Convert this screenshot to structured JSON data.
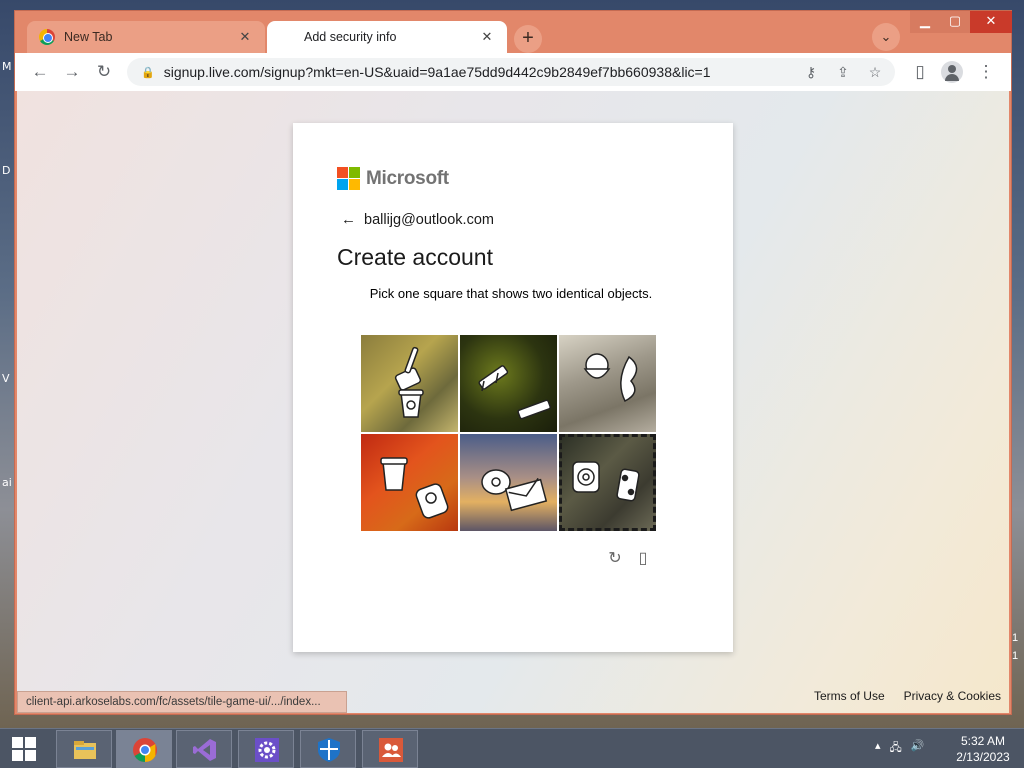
{
  "desktop": {
    "left_letters": [
      "M",
      "D",
      "V",
      "ai"
    ],
    "right_letters": [
      "1",
      "1"
    ]
  },
  "browser": {
    "tabs": [
      {
        "title": "New Tab",
        "close": "✕"
      },
      {
        "title": "Add security info",
        "close": "✕"
      }
    ],
    "newtab_symbol": "+",
    "tabsearch_symbol": "⌄",
    "window_controls": {
      "minimize": "▁",
      "maximize": "▢",
      "close": "✕"
    },
    "toolbar": {
      "back": "←",
      "forward": "→",
      "reload": "↻",
      "url": "signup.live.com/signup?mkt=en-US&uaid=9a1ae75dd9d442c9b2849ef7bb660938&lic=1",
      "key_icon": "⚷",
      "share_icon": "⇪",
      "star_icon": "☆",
      "sidepanel_icon": "▯",
      "menu_icon": "⋮"
    },
    "status_url": "client-api.arkoselabs.com/fc/assets/tile-game-ui/.../index..."
  },
  "signup": {
    "brand": "Microsoft",
    "back_arrow": "←",
    "email": "ballijg@outlook.com",
    "heading": "Create account",
    "prompt": "Pick one square that shows two identical objects.",
    "tiles": [
      {
        "name": "tile-1",
        "selected": false
      },
      {
        "name": "tile-2",
        "selected": false
      },
      {
        "name": "tile-3",
        "selected": false
      },
      {
        "name": "tile-4",
        "selected": false
      },
      {
        "name": "tile-5",
        "selected": false
      },
      {
        "name": "tile-6",
        "selected": true
      }
    ],
    "reload_icon": "↻",
    "audio_icon": "▯"
  },
  "footer": {
    "terms": "Terms of Use",
    "privacy": "Privacy & Cookies"
  },
  "taskbar": {
    "apps": [
      "file-explorer-icon",
      "chrome-icon",
      "visual-studio-icon",
      "settings-icon",
      "defender-icon",
      "people-icon"
    ],
    "tray_chevron": "▴",
    "network_icon": "🖧",
    "volume_icon": "🔊",
    "time": "5:32 AM",
    "date": "2/13/2023"
  },
  "colors": {
    "window_frame": "#e2876a",
    "ms_red": "#f25022",
    "ms_green": "#7fba00",
    "ms_blue": "#00a4ef",
    "ms_yellow": "#ffb900"
  }
}
